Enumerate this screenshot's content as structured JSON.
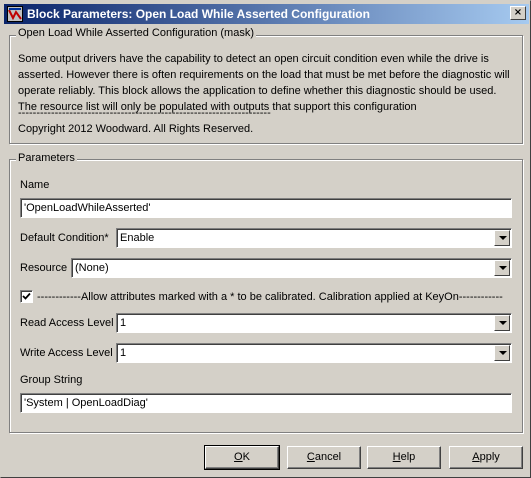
{
  "window": {
    "title": "Block Parameters: Open Load While Asserted Configuration",
    "close_glyph": "×"
  },
  "mask_group": {
    "label": "Open Load While Asserted Configuration (mask)",
    "description": "Some output drivers have the capability to detect an open circuit condition even while the drive is asserted. However there is often requirements on the load that must be met before the diagnostic will operate reliably. This block allows the application to define whether this diagnostic should be used. The resource list will only be populated with outputs that support this configuration",
    "dashes": "---------------------------------------------------------------------",
    "copyright": "Copyright 2012 Woodward.  All Rights Reserved."
  },
  "params": {
    "label": "Parameters",
    "name_label": "Name",
    "name_value": "'OpenLoadWhileAsserted'",
    "default_condition_label": "Default Condition*",
    "default_condition_value": "Enable",
    "resource_label": "Resource",
    "resource_value": "(None)",
    "calibrate_checked": true,
    "calibrate_label": "------------Allow attributes marked with a * to be calibrated. Calibration applied at KeyOn------------",
    "read_access_label": "Read Access Level",
    "read_access_value": "1",
    "write_access_label": "Write Access Level",
    "write_access_value": "1",
    "group_string_label": "Group String",
    "group_string_value": "'System | OpenLoadDiag'"
  },
  "buttons": {
    "ok": {
      "pre": "",
      "mn": "O",
      "post": "K"
    },
    "cancel": {
      "pre": "",
      "mn": "C",
      "post": "ancel"
    },
    "help": {
      "pre": "",
      "mn": "H",
      "post": "elp"
    },
    "apply": {
      "pre": "",
      "mn": "A",
      "post": "pply"
    }
  }
}
